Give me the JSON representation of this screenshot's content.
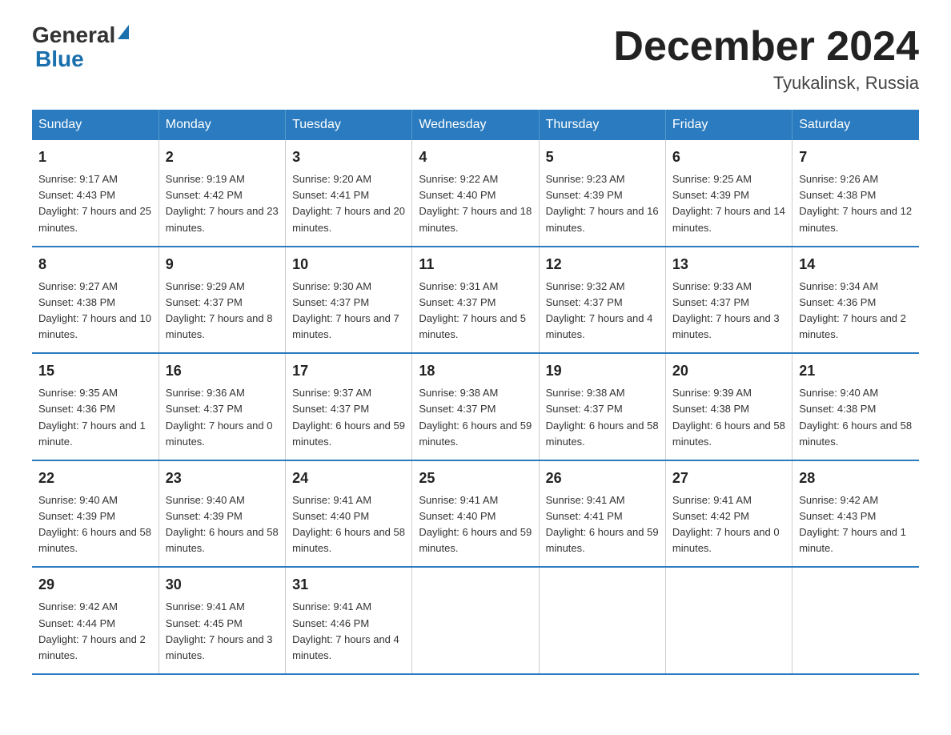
{
  "logo": {
    "general": "General",
    "blue": "Blue"
  },
  "title": "December 2024",
  "location": "Tyukalinsk, Russia",
  "days_of_week": [
    "Sunday",
    "Monday",
    "Tuesday",
    "Wednesday",
    "Thursday",
    "Friday",
    "Saturday"
  ],
  "weeks": [
    [
      {
        "day": "1",
        "sunrise": "9:17 AM",
        "sunset": "4:43 PM",
        "daylight": "7 hours and 25 minutes."
      },
      {
        "day": "2",
        "sunrise": "9:19 AM",
        "sunset": "4:42 PM",
        "daylight": "7 hours and 23 minutes."
      },
      {
        "day": "3",
        "sunrise": "9:20 AM",
        "sunset": "4:41 PM",
        "daylight": "7 hours and 20 minutes."
      },
      {
        "day": "4",
        "sunrise": "9:22 AM",
        "sunset": "4:40 PM",
        "daylight": "7 hours and 18 minutes."
      },
      {
        "day": "5",
        "sunrise": "9:23 AM",
        "sunset": "4:39 PM",
        "daylight": "7 hours and 16 minutes."
      },
      {
        "day": "6",
        "sunrise": "9:25 AM",
        "sunset": "4:39 PM",
        "daylight": "7 hours and 14 minutes."
      },
      {
        "day": "7",
        "sunrise": "9:26 AM",
        "sunset": "4:38 PM",
        "daylight": "7 hours and 12 minutes."
      }
    ],
    [
      {
        "day": "8",
        "sunrise": "9:27 AM",
        "sunset": "4:38 PM",
        "daylight": "7 hours and 10 minutes."
      },
      {
        "day": "9",
        "sunrise": "9:29 AM",
        "sunset": "4:37 PM",
        "daylight": "7 hours and 8 minutes."
      },
      {
        "day": "10",
        "sunrise": "9:30 AM",
        "sunset": "4:37 PM",
        "daylight": "7 hours and 7 minutes."
      },
      {
        "day": "11",
        "sunrise": "9:31 AM",
        "sunset": "4:37 PM",
        "daylight": "7 hours and 5 minutes."
      },
      {
        "day": "12",
        "sunrise": "9:32 AM",
        "sunset": "4:37 PM",
        "daylight": "7 hours and 4 minutes."
      },
      {
        "day": "13",
        "sunrise": "9:33 AM",
        "sunset": "4:37 PM",
        "daylight": "7 hours and 3 minutes."
      },
      {
        "day": "14",
        "sunrise": "9:34 AM",
        "sunset": "4:36 PM",
        "daylight": "7 hours and 2 minutes."
      }
    ],
    [
      {
        "day": "15",
        "sunrise": "9:35 AM",
        "sunset": "4:36 PM",
        "daylight": "7 hours and 1 minute."
      },
      {
        "day": "16",
        "sunrise": "9:36 AM",
        "sunset": "4:37 PM",
        "daylight": "7 hours and 0 minutes."
      },
      {
        "day": "17",
        "sunrise": "9:37 AM",
        "sunset": "4:37 PM",
        "daylight": "6 hours and 59 minutes."
      },
      {
        "day": "18",
        "sunrise": "9:38 AM",
        "sunset": "4:37 PM",
        "daylight": "6 hours and 59 minutes."
      },
      {
        "day": "19",
        "sunrise": "9:38 AM",
        "sunset": "4:37 PM",
        "daylight": "6 hours and 58 minutes."
      },
      {
        "day": "20",
        "sunrise": "9:39 AM",
        "sunset": "4:38 PM",
        "daylight": "6 hours and 58 minutes."
      },
      {
        "day": "21",
        "sunrise": "9:40 AM",
        "sunset": "4:38 PM",
        "daylight": "6 hours and 58 minutes."
      }
    ],
    [
      {
        "day": "22",
        "sunrise": "9:40 AM",
        "sunset": "4:39 PM",
        "daylight": "6 hours and 58 minutes."
      },
      {
        "day": "23",
        "sunrise": "9:40 AM",
        "sunset": "4:39 PM",
        "daylight": "6 hours and 58 minutes."
      },
      {
        "day": "24",
        "sunrise": "9:41 AM",
        "sunset": "4:40 PM",
        "daylight": "6 hours and 58 minutes."
      },
      {
        "day": "25",
        "sunrise": "9:41 AM",
        "sunset": "4:40 PM",
        "daylight": "6 hours and 59 minutes."
      },
      {
        "day": "26",
        "sunrise": "9:41 AM",
        "sunset": "4:41 PM",
        "daylight": "6 hours and 59 minutes."
      },
      {
        "day": "27",
        "sunrise": "9:41 AM",
        "sunset": "4:42 PM",
        "daylight": "7 hours and 0 minutes."
      },
      {
        "day": "28",
        "sunrise": "9:42 AM",
        "sunset": "4:43 PM",
        "daylight": "7 hours and 1 minute."
      }
    ],
    [
      {
        "day": "29",
        "sunrise": "9:42 AM",
        "sunset": "4:44 PM",
        "daylight": "7 hours and 2 minutes."
      },
      {
        "day": "30",
        "sunrise": "9:41 AM",
        "sunset": "4:45 PM",
        "daylight": "7 hours and 3 minutes."
      },
      {
        "day": "31",
        "sunrise": "9:41 AM",
        "sunset": "4:46 PM",
        "daylight": "7 hours and 4 minutes."
      },
      null,
      null,
      null,
      null
    ]
  ],
  "labels": {
    "sunrise": "Sunrise:",
    "sunset": "Sunset:",
    "daylight": "Daylight:"
  }
}
